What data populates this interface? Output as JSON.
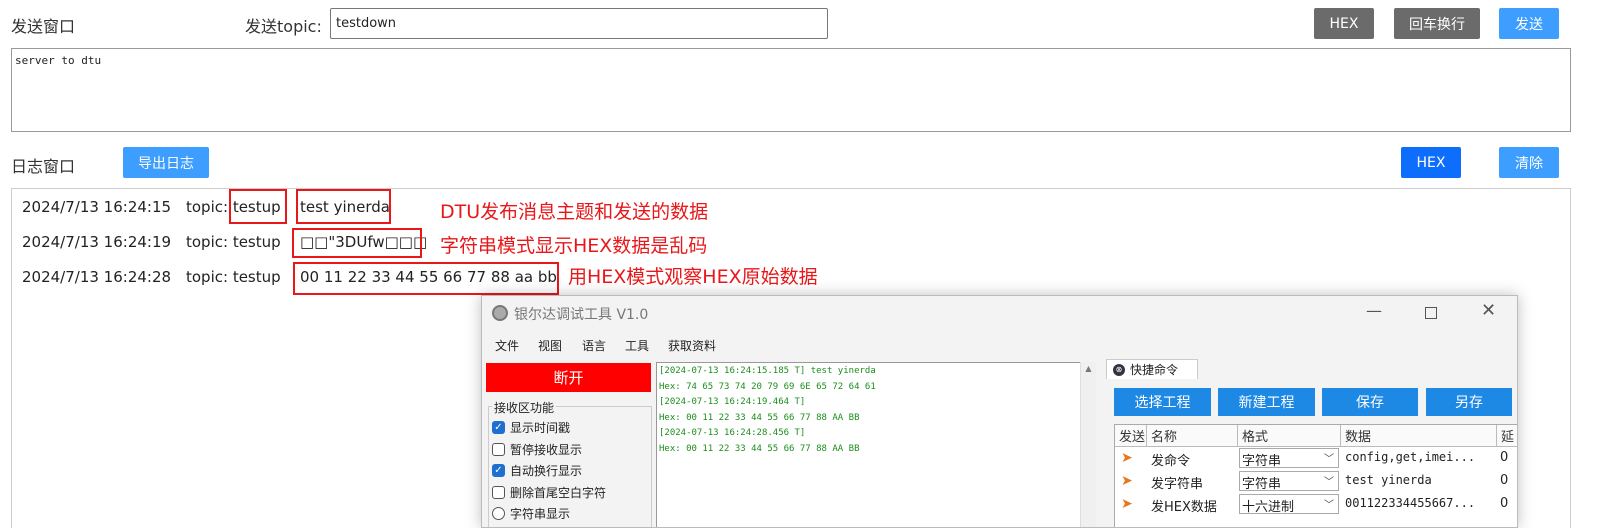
{
  "send_section": {
    "label": "发送窗口",
    "topic_label": "发送topic:",
    "topic_value": "testdown",
    "hex_button": "HEX",
    "newline_button": "回车换行",
    "send_button": "发送",
    "message": "server to dtu"
  },
  "log_section": {
    "label": "日志窗口",
    "export_button": "导出日志",
    "hex_button": "HEX",
    "clear_button": "清除",
    "entries": [
      {
        "time": "2024/7/13 16:24:15",
        "topic": "topic: testup",
        "payload": "test yinerda"
      },
      {
        "time": "2024/7/13 16:24:19",
        "topic": "topic: testup",
        "payload": "□□\"3DUfw□□□"
      },
      {
        "time": "2024/7/13 16:24:28",
        "topic": "topic: testup",
        "payload": "00 11 22 33 44 55 66 77 88 aa bb"
      }
    ],
    "annotations": [
      "DTU发布消息主题和发送的数据",
      "字符串模式显示HEX数据是乱码",
      "用HEX模式观察HEX原始数据"
    ]
  },
  "tool_window": {
    "title": "银尔达调试工具 V1.0",
    "menu": [
      "文件",
      "视图",
      "语言",
      "工具",
      "获取资料"
    ],
    "disconnect_button": "断开",
    "receive_group": "接收区功能",
    "options": [
      {
        "label": "显示时间戳",
        "checked": true
      },
      {
        "label": "暂停接收显示",
        "checked": false
      },
      {
        "label": "自动换行显示",
        "checked": true
      },
      {
        "label": "删除首尾空白字符",
        "checked": false
      },
      {
        "label": "字符串显示",
        "checked": false
      }
    ],
    "receive_lines": [
      "[2024-07-13 16:24:15.185 T] test yinerda",
      "Hex: 74 65 73 74 20 79 69 6E 65 72 64 61",
      "[2024-07-13 16:24:19.464 T]",
      "Hex: 00 11 22 33 44 55 66 77 88 AA BB",
      "[2024-07-13 16:24:28.456 T]",
      "Hex: 00 11 22 33 44 55 66 77 88 AA BB"
    ],
    "quick_tab": "快捷命令",
    "quick_buttons": [
      "选择工程",
      "新建工程",
      "保存",
      "另存"
    ],
    "table_headers": [
      "发送",
      "名称",
      "格式",
      "数据",
      "延"
    ],
    "table_rows": [
      {
        "name": "发命令",
        "format": "字符串",
        "data": "config,get,imei...",
        "delay": "0"
      },
      {
        "name": "发字符串",
        "format": "字符串",
        "data": "test yinerda",
        "delay": "0"
      },
      {
        "name": "发HEX数据",
        "format": "十六进制",
        "data": "001122334455667...",
        "delay": "0"
      }
    ]
  }
}
